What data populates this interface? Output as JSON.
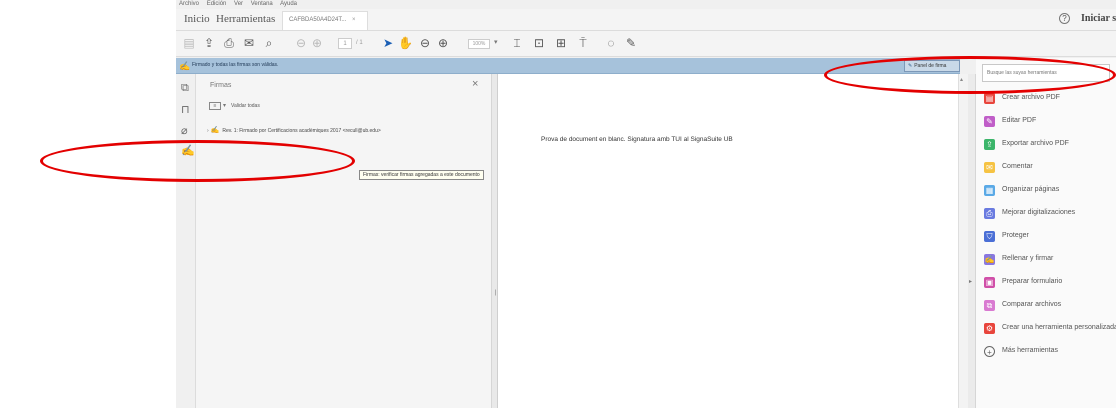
{
  "menu": {
    "items": [
      "Archivo",
      "Edición",
      "Ver",
      "Ventana",
      "Ayuda"
    ]
  },
  "tabs": {
    "home": "Inicio",
    "tools": "Herramientas",
    "document": "CAFBDA50A4D24T...",
    "close": "×"
  },
  "header": {
    "help_icon": "?",
    "signin": "Iniciar sesión"
  },
  "toolbar": {
    "page_current": "1",
    "page_total": "/ 1",
    "zoom": "100%",
    "zoom_dropdown": "▾"
  },
  "signature_bar": {
    "message": "Firmado y todas las firmas son válidas.",
    "panel_button": "Panel de firma"
  },
  "signature_panel": {
    "title": "Firmas",
    "close": "×",
    "validate_all": "Validar todas",
    "dropdown": "▾",
    "row_chevron": "›",
    "signature_row": "Rev. 1: Firmado por Certificacions acadèmiques 2017 <recull@ub.edu>"
  },
  "tooltip": "Firmas: verificar firmas agregadas a este documento",
  "document": {
    "text": "Prova de document en blanc. Signatura amb TUI al SignaSuite UB"
  },
  "tools_panel": {
    "search_placeholder": "Busque las suyas herramientas",
    "items": [
      {
        "label": "Crear archivo PDF",
        "icon": "create-pdf-icon",
        "color": "#e8453c"
      },
      {
        "label": "Editar PDF",
        "icon": "edit-pdf-icon",
        "color": "#c05ec8"
      },
      {
        "label": "Exportar archivo PDF",
        "icon": "export-pdf-icon",
        "color": "#3bb56a"
      },
      {
        "label": "Comentar",
        "icon": "comment-icon",
        "color": "#f6c343"
      },
      {
        "label": "Organizar páginas",
        "icon": "organize-pages-icon",
        "color": "#5aa9e6"
      },
      {
        "label": "Mejorar digitalizaciones",
        "icon": "enhance-scans-icon",
        "color": "#6a7be0"
      },
      {
        "label": "Proteger",
        "icon": "protect-icon",
        "color": "#4b6fd6"
      },
      {
        "label": "Rellenar y firmar",
        "icon": "fill-sign-icon",
        "color": "#8a78e0"
      },
      {
        "label": "Preparar formulario",
        "icon": "prepare-form-icon",
        "color": "#d04fa8"
      },
      {
        "label": "Comparar archivos",
        "icon": "compare-icon",
        "color": "#d97ad1"
      },
      {
        "label": "Crear una herramienta personalizada",
        "icon": "custom-tool-icon",
        "color": "#e8453c"
      },
      {
        "label": "Más herramientas",
        "icon": "more-tools-icon",
        "color": "#666666"
      }
    ]
  },
  "annotations": {
    "color": "#e30000"
  }
}
